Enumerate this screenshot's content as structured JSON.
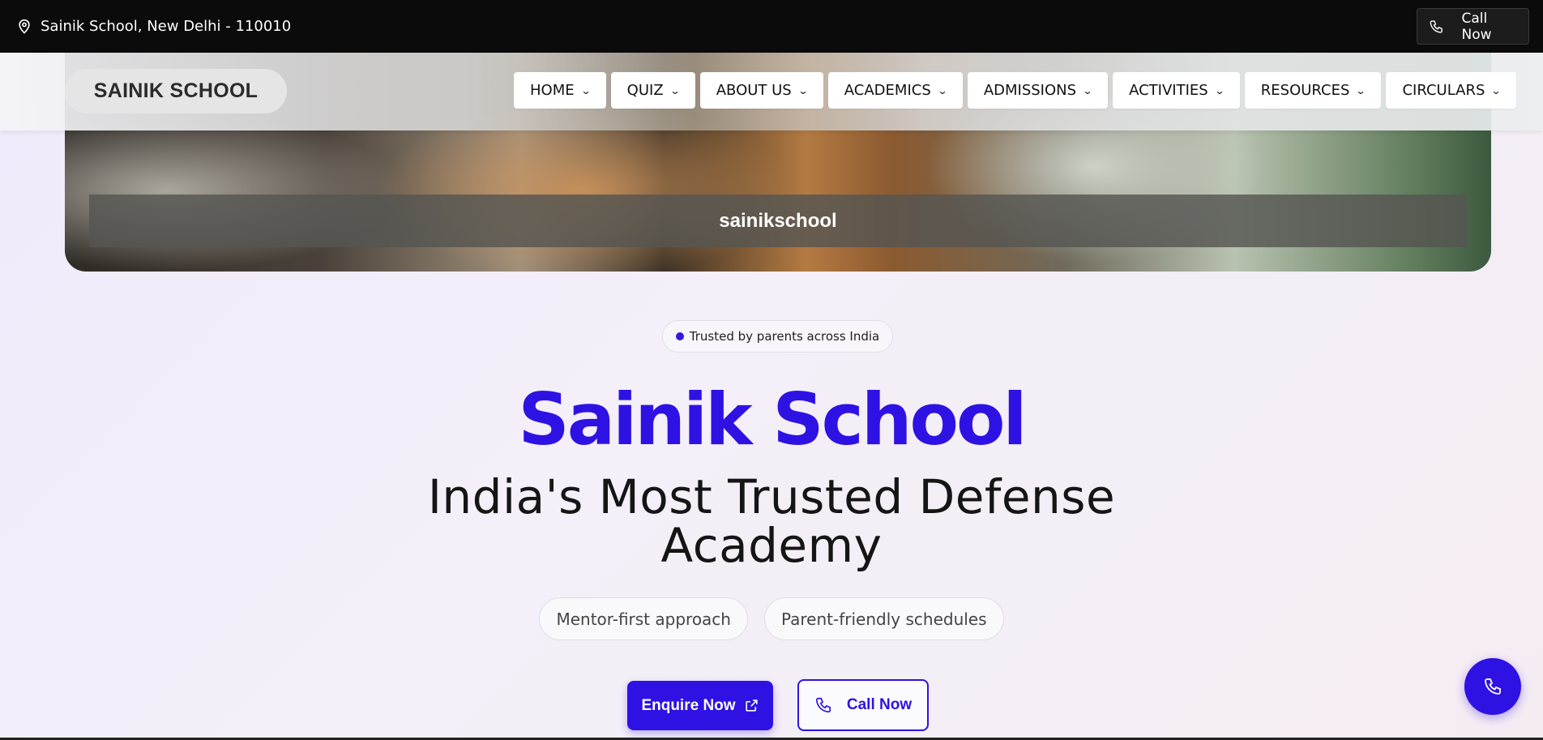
{
  "topbar": {
    "location": "Sainik School, New Delhi - 110010",
    "location_icon": "map-pin-icon",
    "call_label": "Call Now",
    "call_icon": "phone-icon"
  },
  "navbar": {
    "brand": "SAINIK SCHOOL",
    "items": [
      {
        "label": "HOME"
      },
      {
        "label": "QUIZ"
      },
      {
        "label": "ABOUT US"
      },
      {
        "label": "ACADEMICS"
      },
      {
        "label": "ADMISSIONS"
      },
      {
        "label": "ACTIVITIES"
      },
      {
        "label": "RESOURCES"
      },
      {
        "label": "CIRCULARS"
      }
    ]
  },
  "hero": {
    "caption": "sainikschool"
  },
  "main": {
    "badge": "Trusted by parents across India",
    "title": "Sainik School",
    "subtitle": "India's Most Trusted Defense Academy",
    "pills": [
      "Mentor-first approach",
      "Parent-friendly schedules"
    ],
    "enquire_label": "Enquire Now",
    "call_label": "Call Now"
  },
  "colors": {
    "accent": "#2e12e4",
    "topbar": "#0b0b0b"
  }
}
